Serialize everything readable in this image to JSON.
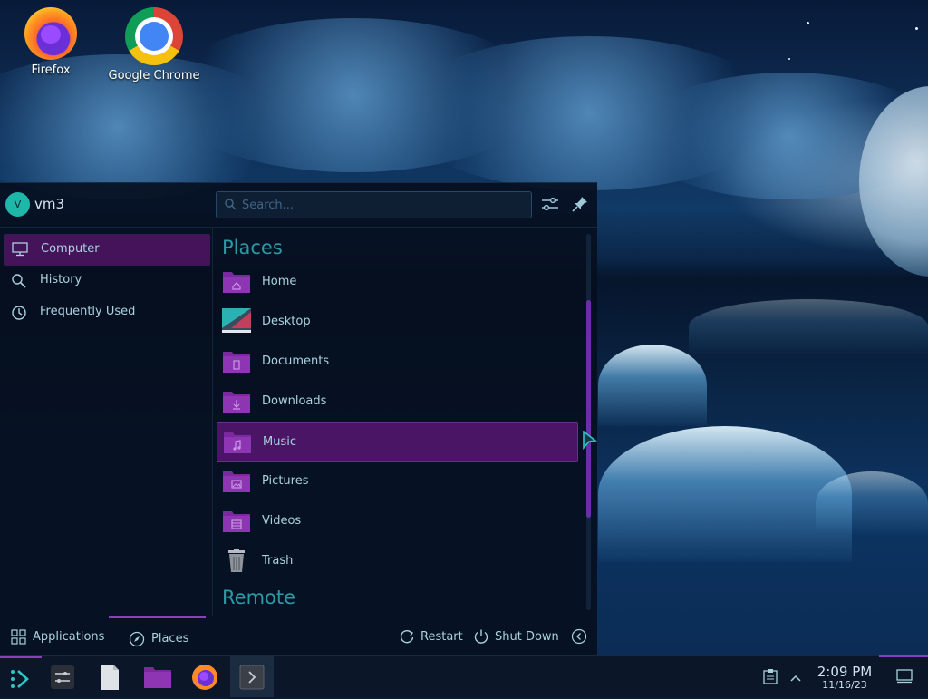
{
  "desktop": {
    "icons": [
      {
        "label": "Firefox"
      },
      {
        "label": "Google Chrome"
      }
    ]
  },
  "launcher": {
    "user": {
      "avatar_letter": "V",
      "name": "vm3"
    },
    "search": {
      "placeholder": "Search..."
    },
    "sidebar": [
      {
        "label": "Computer",
        "icon": "monitor-icon",
        "active": true
      },
      {
        "label": "History",
        "icon": "magnifier-icon"
      },
      {
        "label": "Frequently Used",
        "icon": "clock-icon"
      }
    ],
    "sections": {
      "places": "Places",
      "remote": "Remote"
    },
    "places": [
      {
        "label": "Home",
        "icon": "folder-home-icon"
      },
      {
        "label": "Desktop",
        "icon": "desktop-icon"
      },
      {
        "label": "Documents",
        "icon": "folder-documents-icon"
      },
      {
        "label": "Downloads",
        "icon": "folder-downloads-icon"
      },
      {
        "label": "Music",
        "icon": "folder-music-icon",
        "active": true
      },
      {
        "label": "Pictures",
        "icon": "folder-pictures-icon"
      },
      {
        "label": "Videos",
        "icon": "folder-videos-icon"
      },
      {
        "label": "Trash",
        "icon": "trash-icon"
      }
    ],
    "footer": {
      "applications": "Applications",
      "places": "Places",
      "restart": "Restart",
      "shutdown": "Shut Down"
    }
  },
  "taskbar": {
    "time": "2:09 PM",
    "date": "11/16/23"
  },
  "colors": {
    "accent": "#8a3fc0",
    "highlight": "#4e1668",
    "section_title": "#2a9aa6",
    "folder": "#7a2a9e"
  }
}
